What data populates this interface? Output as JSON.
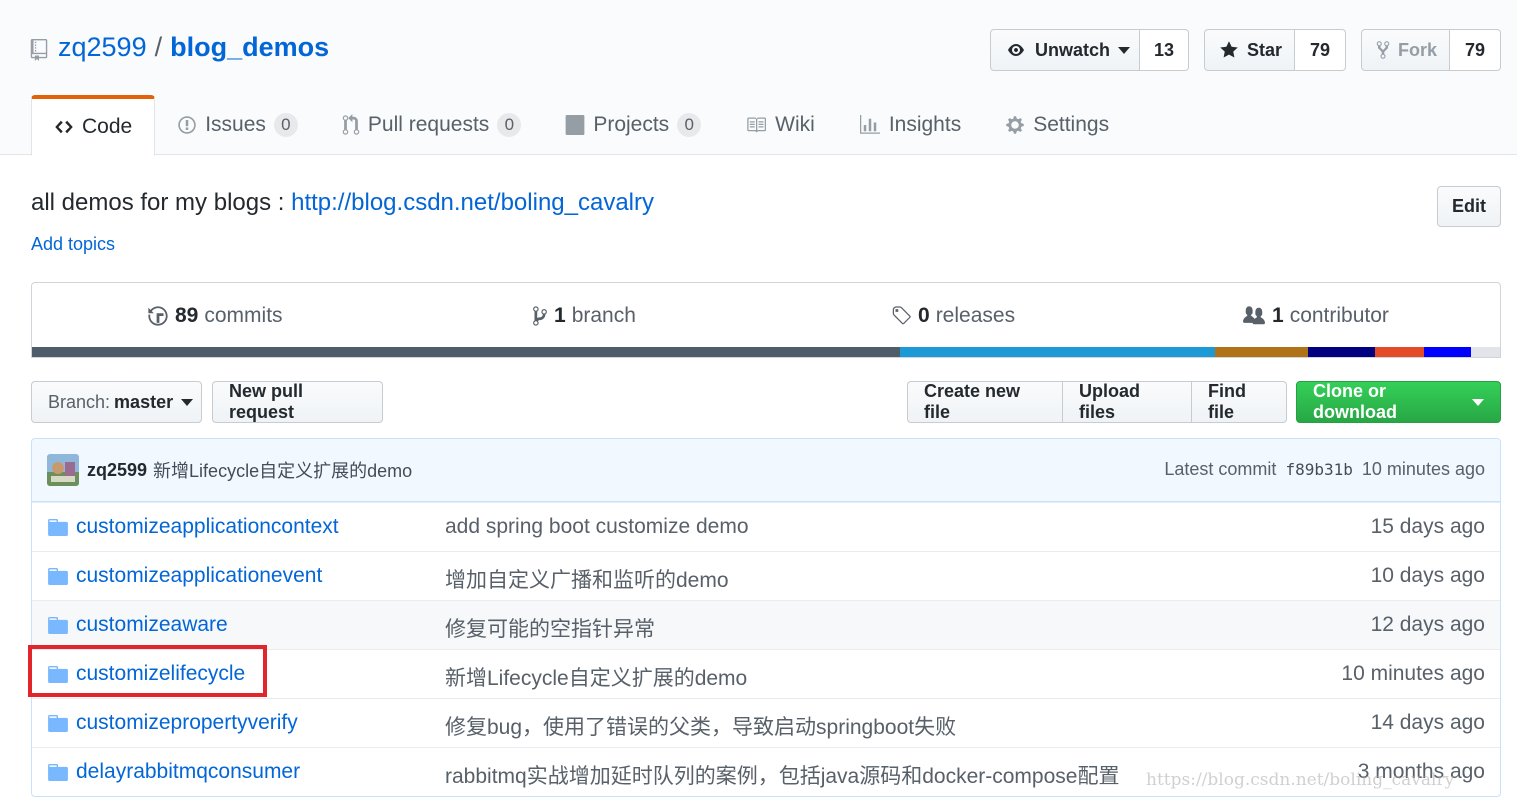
{
  "repo": {
    "owner": "zq2599",
    "separator": "/",
    "name": "blog_demos"
  },
  "actions": {
    "watch_label": "Unwatch",
    "watch_count": "13",
    "star_label": "Star",
    "star_count": "79",
    "fork_label": "Fork",
    "fork_count": "79"
  },
  "tabs": [
    {
      "label": "Code",
      "icon": "code-icon"
    },
    {
      "label": "Issues",
      "count": "0",
      "icon": "issue-icon"
    },
    {
      "label": "Pull requests",
      "count": "0",
      "icon": "pull-request-icon"
    },
    {
      "label": "Projects",
      "count": "0",
      "icon": "project-icon"
    },
    {
      "label": "Wiki",
      "icon": "book-icon"
    },
    {
      "label": "Insights",
      "icon": "graph-icon"
    },
    {
      "label": "Settings",
      "icon": "gear-icon"
    }
  ],
  "description": {
    "text": "all demos for my blogs : ",
    "link": "http://blog.csdn.net/boling_cavalry",
    "add_topics": "Add topics",
    "edit_label": "Edit"
  },
  "summary": {
    "commits_count": "89",
    "commits_label": "commits",
    "branch_count": "1",
    "branch_label": "branch",
    "releases_count": "0",
    "releases_label": "releases",
    "contributor_count": "1",
    "contributor_label": "contributor"
  },
  "language_colors": [
    "#4f5d6a",
    "#1c9ad6",
    "#b07219",
    "#000080",
    "#e34c26",
    "#0000ff",
    "#e1e4e8"
  ],
  "language_shares": [
    0.591,
    0.215,
    0.063,
    0.046,
    0.033,
    0.032,
    0.02
  ],
  "file_nav": {
    "branch_prefix": "Branch:",
    "branch_name": "master",
    "new_pull_request": "New pull request",
    "create_new_file": "Create new file",
    "upload_files": "Upload files",
    "find_file": "Find file",
    "clone_or_download": "Clone or download"
  },
  "latest_commit": {
    "author": "zq2599",
    "message": "新增Lifecycle自定义扩展的demo",
    "prefix": "Latest commit",
    "sha": "f89b31b",
    "age": "10 minutes ago"
  },
  "files": [
    {
      "name": "customizeapplicationcontext",
      "message": "add spring boot customize demo",
      "age": "15 days ago"
    },
    {
      "name": "customizeapplicationevent",
      "message": "增加自定义广播和监听的demo",
      "age": "10 days ago"
    },
    {
      "name": "customizeaware",
      "message": "修复可能的空指针异常",
      "age": "12 days ago"
    },
    {
      "name": "customizelifecycle",
      "message": "新增Lifecycle自定义扩展的demo",
      "age": "10 minutes ago"
    },
    {
      "name": "customizepropertyverify",
      "message": "修复bug，使用了错误的父类，导致启动springboot失败",
      "age": "14 days ago"
    },
    {
      "name": "delayrabbitmqconsumer",
      "message": "rabbitmq实战增加延时队列的案例，包括java源码和docker-compose配置",
      "age": "3 months ago"
    }
  ],
  "watermark": "https://blog.csdn.net/boling_cavalry"
}
